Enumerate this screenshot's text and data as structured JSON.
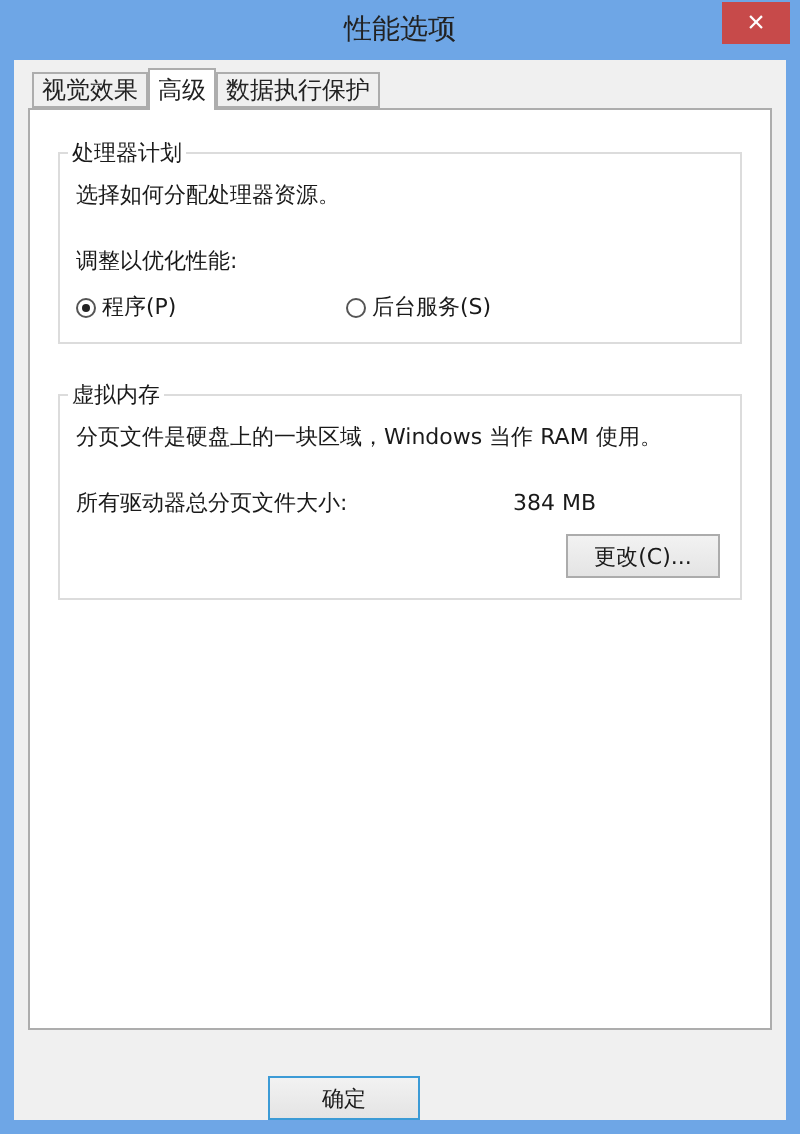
{
  "window": {
    "title": "性能选项",
    "close": "×"
  },
  "tabs": [
    {
      "label": "视觉效果",
      "selected": false
    },
    {
      "label": "高级",
      "selected": true
    },
    {
      "label": "数据执行保护",
      "selected": false
    }
  ],
  "processor_group": {
    "title": "处理器计划",
    "description": "选择如何分配处理器资源。",
    "adjust_label": "调整以优化性能:",
    "options": [
      {
        "label": "程序(P)",
        "selected": true
      },
      {
        "label": "后台服务(S)",
        "selected": false
      }
    ]
  },
  "virtual_memory_group": {
    "title": "虚拟内存",
    "description": "分页文件是硬盘上的一块区域，Windows 当作 RAM 使用。",
    "total_label": "所有驱动器总分页文件大小:",
    "total_value": "384 MB",
    "change_button": "更改(C)..."
  },
  "buttons": [
    "确定"
  ]
}
